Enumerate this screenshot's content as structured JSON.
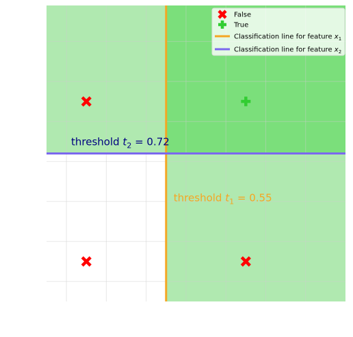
{
  "chart_data": {
    "type": "scatter",
    "title": "",
    "xlabel": "",
    "ylabel": "",
    "xlim": [
      0.25,
      1.0
    ],
    "ylim": [
      0.35,
      1.09
    ],
    "grid": true,
    "legend_position": "top-right",
    "series": [
      {
        "name": "False",
        "marker": "x-thick",
        "color": "#ff0000",
        "points": [
          {
            "x": 0.35,
            "y": 0.85
          },
          {
            "x": 0.35,
            "y": 0.45
          },
          {
            "x": 0.75,
            "y": 0.45
          }
        ]
      },
      {
        "name": "True",
        "marker": "plus-thick",
        "color": "#32cd32",
        "points": [
          {
            "x": 0.75,
            "y": 0.85
          }
        ]
      }
    ],
    "threshold_lines": [
      {
        "legend_label": "Classification line for feature x",
        "legend_subscript": "1",
        "orientation": "vertical",
        "value": 0.55,
        "color": "#f5a623",
        "annotation": {
          "prefix": "threshold ",
          "var": "t",
          "sub": "1",
          "suffix": " = 0.55"
        }
      },
      {
        "legend_label": "Classification line for feature x",
        "legend_subscript": "2",
        "orientation": "horizontal",
        "value": 0.72,
        "color": "#7b68ee",
        "annotation": {
          "prefix": "threshold ",
          "var": "t",
          "sub": "2",
          "suffix": " = 0.72"
        }
      }
    ],
    "regions": [
      {
        "x": [
          0.25,
          0.55
        ],
        "y": [
          0.72,
          1.09
        ],
        "color": "#7fdc7f",
        "opacity": 0.62
      },
      {
        "x": [
          0.55,
          1.0
        ],
        "y": [
          0.35,
          0.72
        ],
        "color": "#7fdc7f",
        "opacity": 0.62
      },
      {
        "x": [
          0.55,
          1.0
        ],
        "y": [
          0.72,
          1.09
        ],
        "color": "#70dc70",
        "opacity": 0.92
      }
    ],
    "annotation_colors": {
      "threshold_1": "#f5a623",
      "threshold_2": "#000080"
    }
  }
}
